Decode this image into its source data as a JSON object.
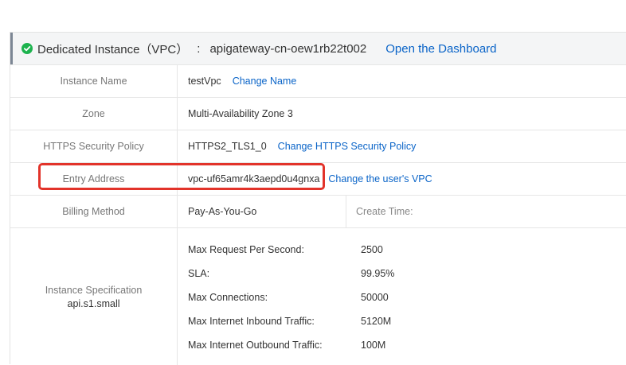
{
  "header": {
    "title": "Dedicated Instance（VPC）",
    "separator": ":",
    "instance_id": "apigateway-cn-oew1rb22t002",
    "dashboard_link": "Open the Dashboard",
    "status_color": "#1db34e"
  },
  "rows": {
    "instance_name": {
      "label": "Instance Name",
      "value": "testVpc",
      "link": "Change Name"
    },
    "zone": {
      "label": "Zone",
      "value": "Multi-Availability Zone 3"
    },
    "https_policy": {
      "label": "HTTPS Security Policy",
      "value": "HTTPS2_TLS1_0",
      "link": "Change HTTPS Security Policy"
    },
    "entry_address": {
      "label": "Entry Address",
      "value": "vpc-uf65amr4k3aepd0u4gnxa",
      "link": "Change the user's VPC"
    },
    "billing": {
      "label": "Billing Method",
      "value": "Pay-As-You-Go",
      "create_time_label": "Create Time:"
    }
  },
  "spec": {
    "label": "Instance Specification",
    "type": "api.s1.small",
    "items": [
      {
        "name": "Max Request Per Second:",
        "value": "2500"
      },
      {
        "name": "SLA:",
        "value": "99.95%"
      },
      {
        "name": "Max Connections:",
        "value": "50000"
      },
      {
        "name": "Max Internet Inbound Traffic:",
        "value": "5120M"
      },
      {
        "name": "Max Internet Outbound Traffic:",
        "value": "100M"
      }
    ]
  },
  "colors": {
    "link": "#0a64c8",
    "highlight": "#e2332a"
  }
}
